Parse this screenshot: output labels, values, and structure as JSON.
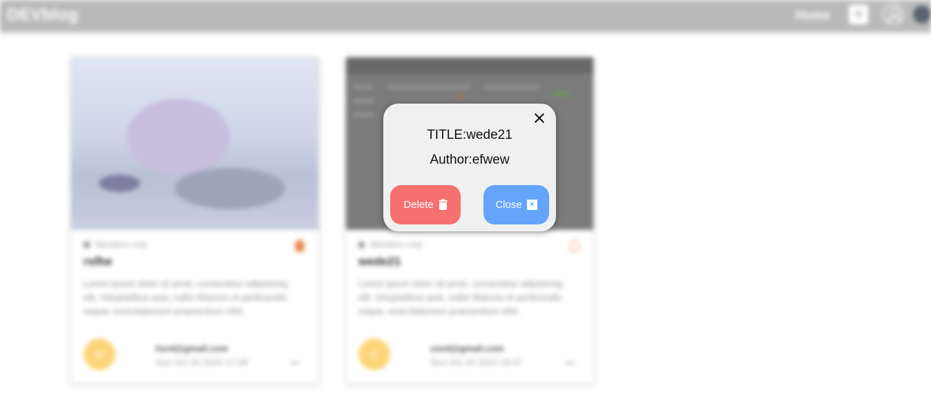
{
  "navbar": {
    "brand": "DEVblog",
    "home_label": "Home",
    "add_icon": "plus-icon",
    "user_icon": "user-icon"
  },
  "cards": [
    {
      "members_label": "Members only",
      "title": "rsfhe",
      "description": "Lorem ipsum dolor sit amet, consectetur adipisicing elit. Voluptatibus quia, nulla! Maiores et perferendis eaque, exercitationem praesentium nihil.",
      "avatar_text": "W",
      "author_email": "hsrd@gmail.com",
      "date": "Sun Oct 20 2024 17:28",
      "more": "•••"
    },
    {
      "members_label": "Members only",
      "title": "wede21",
      "description": "Lorem ipsum dolor sit amet, consectetur adipisicing elit. Voluptatibus quia, nulla! Maiores et perferendis eaque, exercitationem praesentium nihil.",
      "avatar_text": "E",
      "author_email": "sxed@gmail.com",
      "date": "Sun Oct 20 2024 18:47",
      "more": "•••"
    }
  ],
  "modal": {
    "title_text": "TITLE:wede21",
    "author_text": "Author:efwew",
    "delete_label": "Delete",
    "close_label": "Close",
    "close_box_glyph": "×",
    "delete_color": "#f47170",
    "close_color": "#64a4fb"
  }
}
